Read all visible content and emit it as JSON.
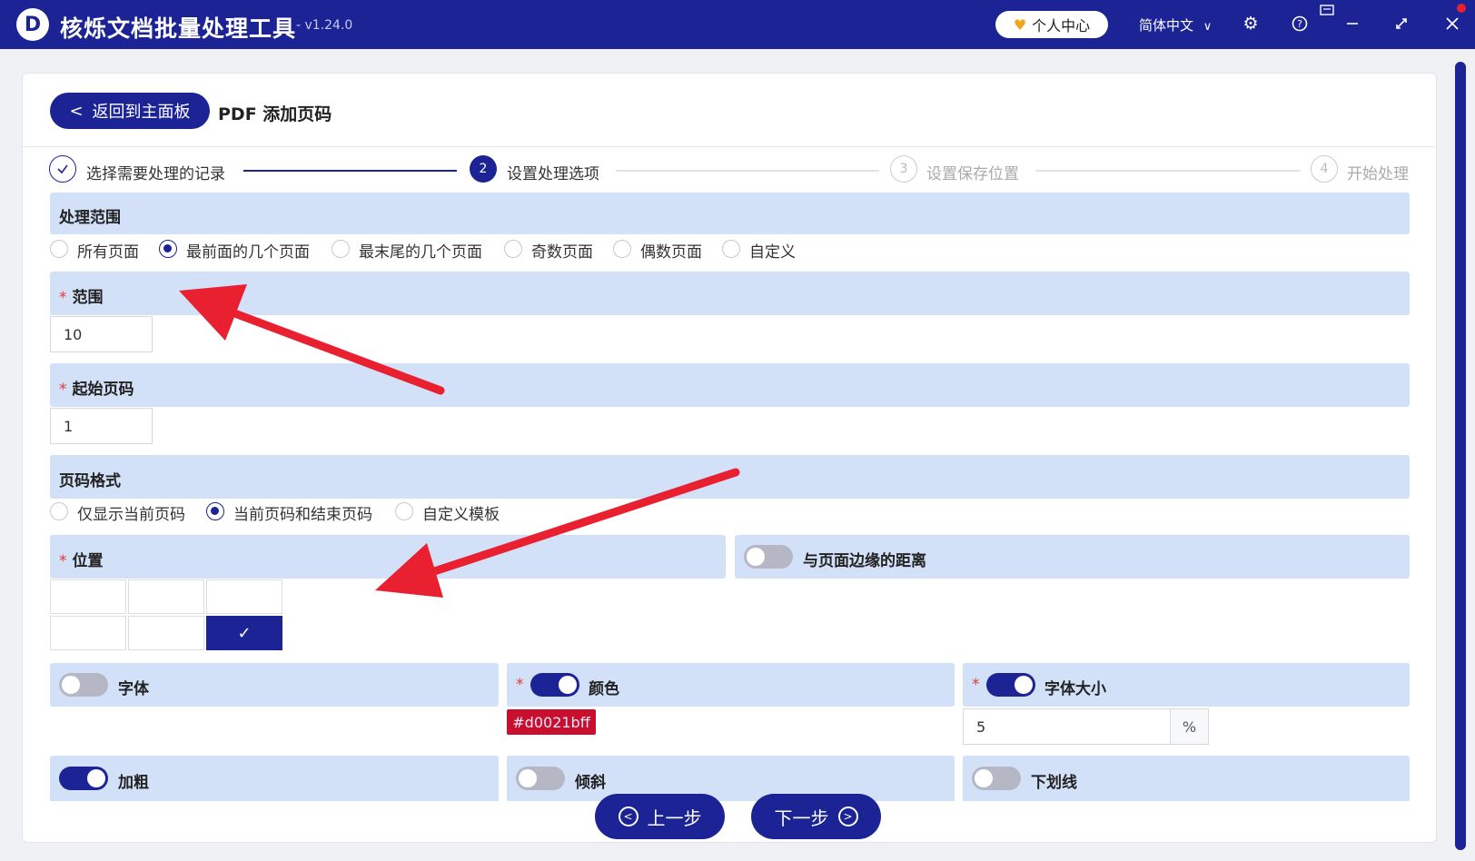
{
  "app": {
    "logo_letter": "D",
    "title": "核烁文档批量处理工具",
    "version": "- v1.24.0",
    "user_center": "个人中心",
    "language": "简体中文"
  },
  "header": {
    "back_label": "返回到主面板",
    "page_title": "PDF 添加页码"
  },
  "steps": [
    {
      "number": "1",
      "label": "选择需要处理的记录",
      "state": "done"
    },
    {
      "number": "2",
      "label": "设置处理选项",
      "state": "active"
    },
    {
      "number": "3",
      "label": "设置保存位置",
      "state": "todo"
    },
    {
      "number": "4",
      "label": "开始处理",
      "state": "todo"
    }
  ],
  "scope": {
    "label": "处理范围",
    "options": [
      "所有页面",
      "最前面的几个页面",
      "最末尾的几个页面",
      "奇数页面",
      "偶数页面",
      "自定义"
    ],
    "selected": "最前面的几个页面"
  },
  "range": {
    "label": "范围",
    "value": "10"
  },
  "start_page": {
    "label": "起始页码",
    "value": "1"
  },
  "format": {
    "label": "页码格式",
    "options": [
      "仅显示当前页码",
      "当前页码和结束页码",
      "自定义模板"
    ],
    "selected": "当前页码和结束页码"
  },
  "position": {
    "label": "位置",
    "selected_cell": "bottom-right",
    "check_mark": "✓"
  },
  "margin": {
    "label": "与页面边缘的距离",
    "enabled": false
  },
  "font": {
    "label": "字体",
    "enabled": false
  },
  "color": {
    "label": "颜色",
    "enabled": true,
    "value": "#d0021bff"
  },
  "font_size": {
    "label": "字体大小",
    "enabled": true,
    "value": "5",
    "unit": "%"
  },
  "bold": {
    "label": "加粗",
    "enabled": true
  },
  "italic": {
    "label": "倾斜",
    "enabled": false
  },
  "underline": {
    "label": "下划线",
    "enabled": false
  },
  "nav": {
    "prev": "上一步",
    "next": "下一步"
  },
  "colors": {
    "primary": "#1b2395",
    "bar": "#d2e0f8",
    "annotation_arrow": "#e8202f"
  }
}
